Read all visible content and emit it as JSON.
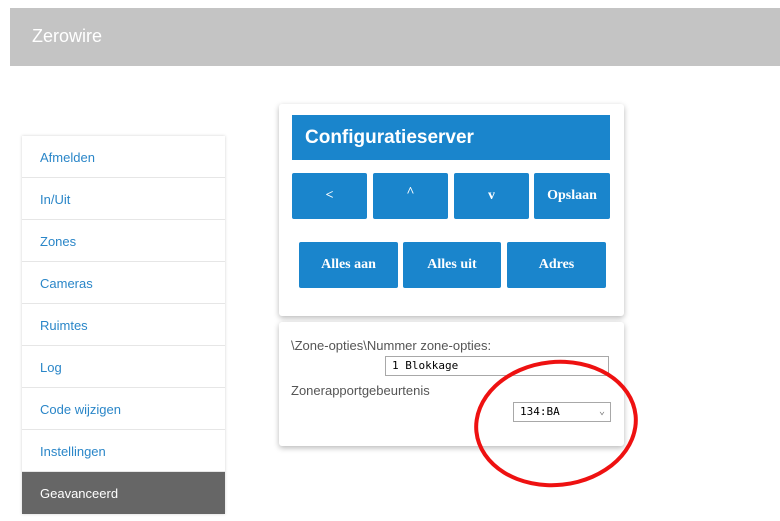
{
  "app": {
    "title": "Zerowire"
  },
  "sidebar": {
    "items": [
      {
        "label": "Afmelden"
      },
      {
        "label": "In/Uit"
      },
      {
        "label": "Zones"
      },
      {
        "label": "Cameras"
      },
      {
        "label": "Ruimtes"
      },
      {
        "label": "Log"
      },
      {
        "label": "Code wijzigen"
      },
      {
        "label": "Instellingen"
      },
      {
        "label": "Geavanceerd",
        "active": true
      }
    ]
  },
  "config": {
    "title": "Configuratieserver",
    "buttons": {
      "prev": "<",
      "up": "^",
      "down": "v",
      "save": "Opslaan",
      "all_on": "Alles aan",
      "all_off": "Alles uit",
      "address": "Adres"
    }
  },
  "options": {
    "path_label": "\\Zone-opties\\Nummer zone-opties:",
    "number_select": {
      "value": "1 Blokkage"
    },
    "event_label": "Zonerapportgebeurtenis",
    "event_select": {
      "value": "134:BA"
    }
  },
  "colors": {
    "accent": "#1a85cc",
    "header": "#c4c4c4",
    "active": "#666666",
    "highlight": "#ee1111"
  }
}
